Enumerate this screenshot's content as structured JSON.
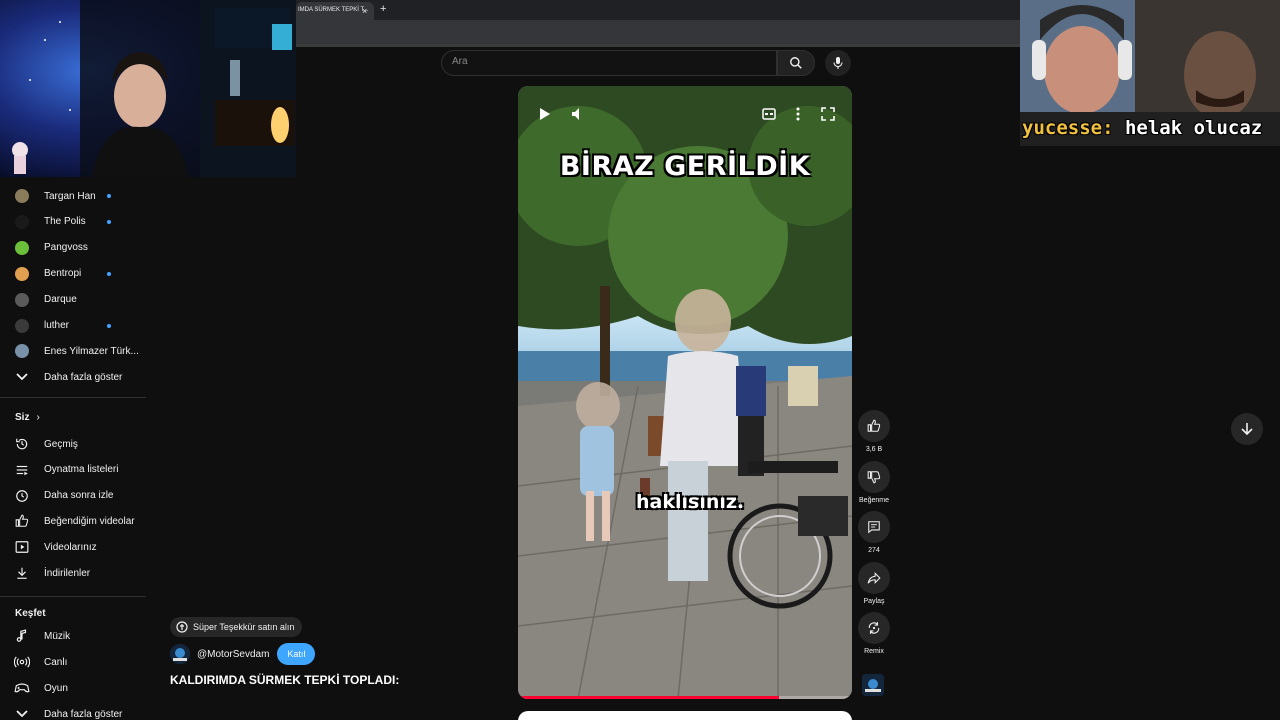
{
  "browser": {
    "tab_title": "IMDA SÜRMEK TEPKİ T...",
    "close_glyph": "×",
    "new_tab_glyph": "+"
  },
  "search": {
    "placeholder": "Ara"
  },
  "stream_overlay": {
    "chat_user": "yucesse:",
    "chat_message": " helak olucaz"
  },
  "sidebar": {
    "subscriptions": [
      {
        "name": "Targan Han",
        "live": true,
        "avatar_color": "#8a7b5a"
      },
      {
        "name": "The Polis",
        "live": true,
        "avatar_color": "#1a1a1a"
      },
      {
        "name": "Pangvoss",
        "live": false,
        "avatar_color": "#6bbf3a"
      },
      {
        "name": "Bentropi",
        "live": true,
        "avatar_color": "#e0a050"
      },
      {
        "name": "Darque",
        "live": false,
        "avatar_color": "#5a5a5a"
      },
      {
        "name": "luther",
        "live": true,
        "avatar_color": "#3a3a3a"
      },
      {
        "name": "Enes Yilmazer Türk...",
        "live": false,
        "avatar_color": "#7890a8"
      }
    ],
    "show_more_1": "Daha fazla göster",
    "you_heading": "Siz",
    "you_items": [
      {
        "label": "Geçmiş",
        "icon": "history-icon"
      },
      {
        "label": "Oynatma listeleri",
        "icon": "playlist-icon"
      },
      {
        "label": "Daha sonra izle",
        "icon": "clock-icon"
      },
      {
        "label": "Beğendiğim videolar",
        "icon": "thumbs-up-icon"
      },
      {
        "label": "Videolarınız",
        "icon": "video-icon"
      },
      {
        "label": "İndirilenler",
        "icon": "download-icon"
      }
    ],
    "explore_heading": "Keşfet",
    "explore_items": [
      {
        "label": "Müzik",
        "icon": "music-icon"
      },
      {
        "label": "Canlı",
        "icon": "live-icon"
      },
      {
        "label": "Oyun",
        "icon": "gaming-icon"
      }
    ],
    "show_more_2": "Daha fazla göster"
  },
  "short": {
    "caption_top": "BİRAZ GERİLDİK",
    "caption_sub": "haklısınız.",
    "progress": 0.78
  },
  "overlay_info": {
    "super_thanks": "Süper Teşekkür satın alın",
    "channel_name": "@MotorSevdam",
    "join_label": "Katıl",
    "title": "KALDIRIMDA SÜRMEK TEPKİ TOPLADI:"
  },
  "actions": {
    "like_count": "3,6 B",
    "dislike_label": "Beğenme",
    "comment_count": "274",
    "share_label": "Paylaş",
    "remix_label": "Remix"
  },
  "colors": {
    "accent_blue": "#3ea6ff",
    "progress_red": "#ff0033",
    "background": "#0f0f0f"
  }
}
